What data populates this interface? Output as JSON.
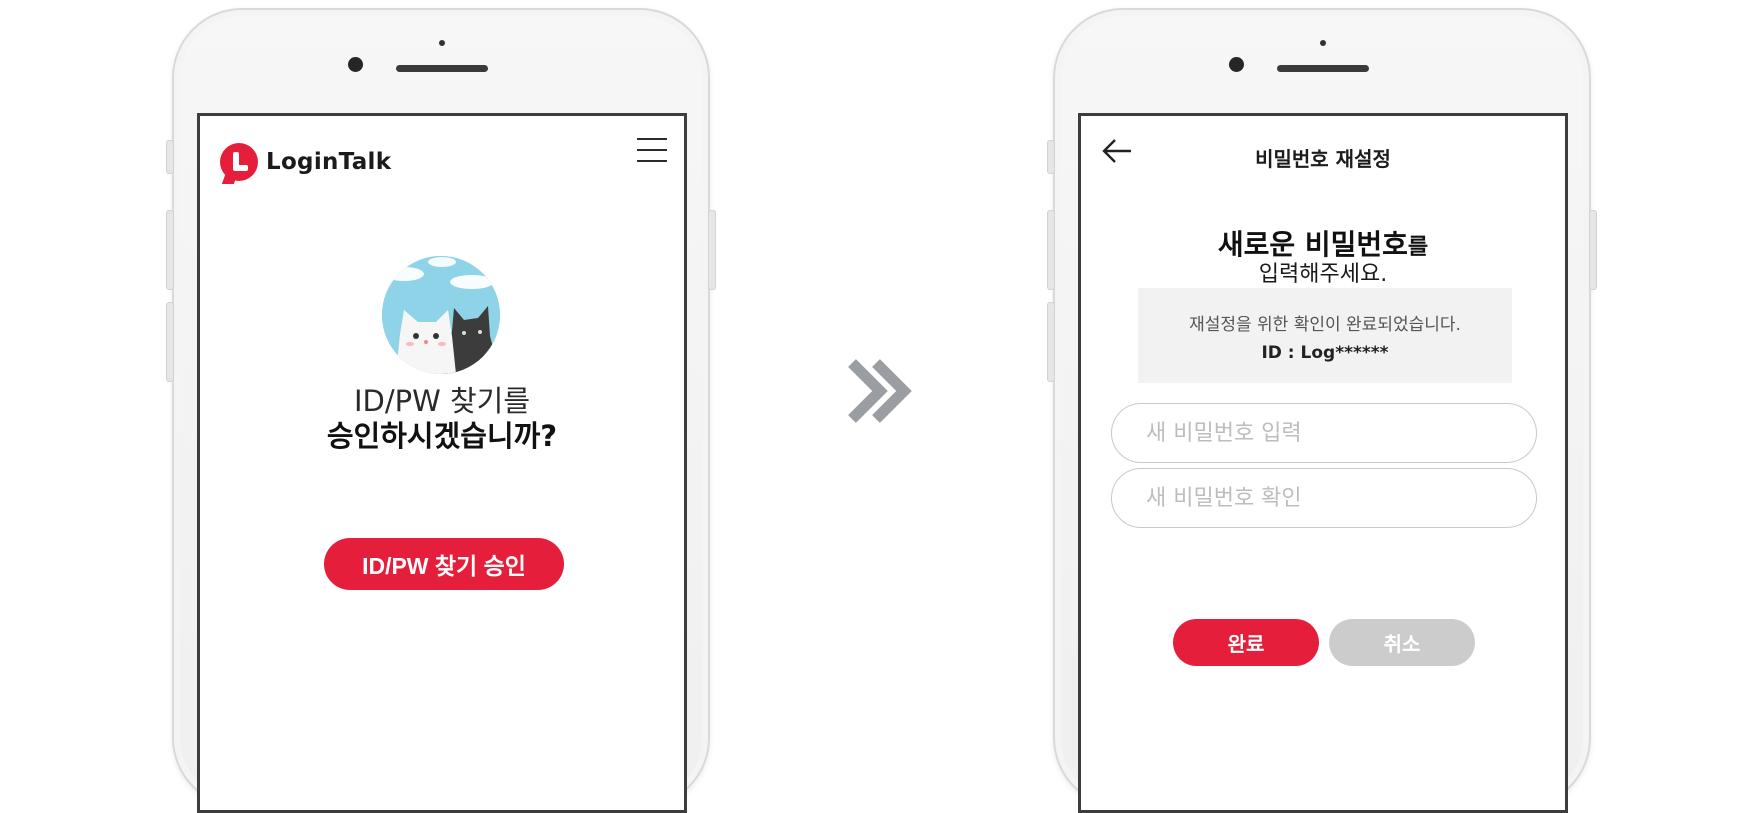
{
  "left_screen": {
    "logo_text": "LoginTalk",
    "menu_icon": "hamburger-icon",
    "illustration": "cats-illustration",
    "title_line1": "ID/PW 찾기를",
    "title_line2": "승인하시겠습니까?",
    "approve_button": "ID/PW 찾기 승인"
  },
  "arrow_icon": "double-chevron-right-icon",
  "right_screen": {
    "back_icon": "back-arrow-icon",
    "page_title": "비밀번호 재설정",
    "heading_bold": "새로운 비밀번호",
    "heading_suffix": "를",
    "heading_line2": "입력해주세요.",
    "info_message": "재설정을 위한 확인이 완료되었습니다.",
    "info_id": "ID : Log******",
    "new_password_placeholder": "새 비밀번호 입력",
    "confirm_password_placeholder": "새 비밀번호 확인",
    "done_button": "완료",
    "cancel_button": "취소"
  },
  "colors": {
    "brand_red": "#e51f3b",
    "cancel_gray": "#cccccc",
    "info_bg": "#f2f2f2",
    "chevron_gray": "#9a9ea3"
  }
}
